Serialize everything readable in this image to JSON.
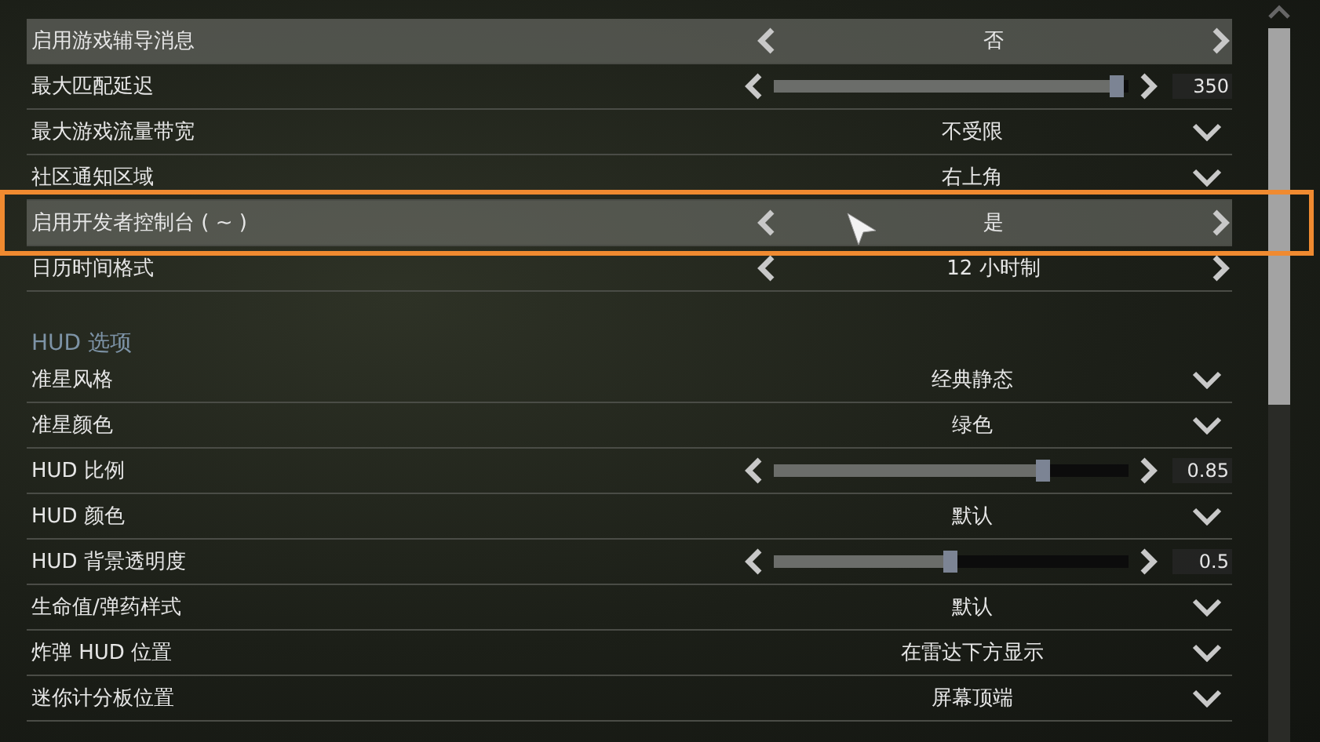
{
  "groups": [
    {
      "rows": [
        {
          "label": "启用游戏辅导消息",
          "kind": "selector",
          "value": "否",
          "highlighted": true
        },
        {
          "label": "最大匹配延迟",
          "kind": "slider",
          "level": 0.97,
          "reading": "350",
          "highlighted": false
        },
        {
          "label": "最大游戏流量带宽",
          "kind": "dropdown",
          "value": "不受限",
          "highlighted": false
        },
        {
          "label": "社区通知区域",
          "kind": "dropdown",
          "value": "右上角",
          "highlighted": false
        },
        {
          "label": "启用开发者控制台 ( ~ )",
          "kind": "selector",
          "value": "是",
          "highlighted": true
        },
        {
          "label": "日历时间格式",
          "kind": "selector",
          "value": "12 小时制",
          "highlighted": false
        }
      ]
    },
    {
      "title": "HUD 选项",
      "rows": [
        {
          "label": "准星风格",
          "kind": "dropdown",
          "value": "经典静态",
          "highlighted": false
        },
        {
          "label": "准星颜色",
          "kind": "dropdown",
          "value": "绿色",
          "highlighted": false
        },
        {
          "label": "HUD 比例",
          "kind": "slider",
          "level": 0.76,
          "reading": "0.85",
          "highlighted": false
        },
        {
          "label": "HUD 颜色",
          "kind": "dropdown",
          "value": "默认",
          "highlighted": false
        },
        {
          "label": "HUD 背景透明度",
          "kind": "slider",
          "level": 0.5,
          "reading": "0.5",
          "highlighted": false
        },
        {
          "label": "生命值/弹药样式",
          "kind": "dropdown",
          "value": "默认",
          "highlighted": false
        },
        {
          "label": "炸弹 HUD 位置",
          "kind": "dropdown",
          "value": "在雷达下方显示",
          "highlighted": false
        },
        {
          "label": "迷你计分板位置",
          "kind": "dropdown",
          "value": "屏幕顶端",
          "highlighted": false
        }
      ]
    }
  ]
}
